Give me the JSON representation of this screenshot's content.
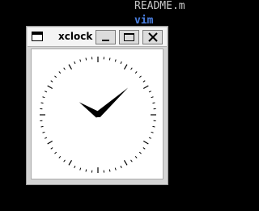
{
  "terminal": {
    "lines": [
      "README.m",
      "vim"
    ]
  },
  "window": {
    "title": "xclock"
  },
  "clock": {
    "hour": 10,
    "minute": 8,
    "hand_color": "#000000",
    "face_color": "#ffffff"
  },
  "icons": {
    "menu": "window-menu-icon",
    "minimize": "minimize-icon",
    "maximize": "maximize-icon",
    "close": "close-icon"
  }
}
